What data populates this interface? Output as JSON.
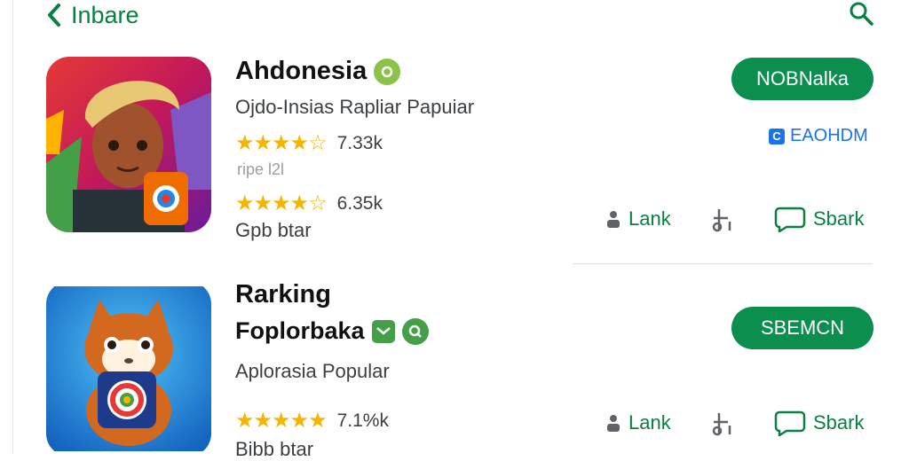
{
  "header": {
    "back_label": "Inbare"
  },
  "apps": [
    {
      "name": "Ahdonesia",
      "subtitle": "Ojdo-Insias Rapliar Papuiar",
      "rating_1": "7.33k",
      "faint_text": "ripe l2l",
      "rating_2": "6.35k",
      "footer": "Gpb btar",
      "install_label": "NOBNalka",
      "badge_label": "EAOHDM",
      "action_1": "Lank",
      "action_2": "Sbark"
    },
    {
      "name": "Rarking",
      "name_line2": "Foplorbaka",
      "subtitle": "Aplorasia Popular",
      "rating_1": "7.1%k",
      "footer": "Bibb btar",
      "install_label": "SBEMCN",
      "action_1": "Lank",
      "action_2": "Sbark"
    }
  ],
  "colors": {
    "accent": "#0b8e4e",
    "star": "#f6b400",
    "link": "#1a73e8"
  }
}
